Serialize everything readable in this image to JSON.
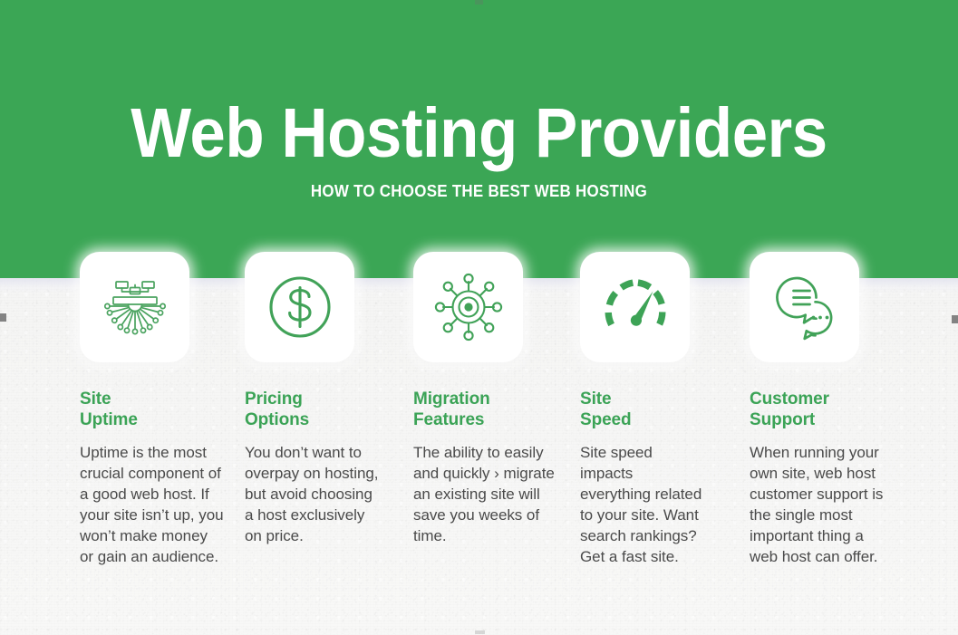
{
  "hero": {
    "title": "Web Hosting Providers",
    "subtitle": "HOW TO CHOOSE THE BEST WEB HOSTING",
    "background_color": "#3BA655",
    "text_color": "#FFFFFF"
  },
  "theme": {
    "brand_green": "#3BA655",
    "heading_green": "#3BA356",
    "body_text": "#4A4A4A",
    "card_background": "#FFFFFF",
    "page_background": "#F7F7F6"
  },
  "columns": [
    {
      "icon": "network-uptime-icon",
      "heading": "Site\nUptime",
      "body": "Uptime is the most crucial component of a good web host. If your site isn’t up, you won’t make money or gain an audience."
    },
    {
      "icon": "dollar-coin-icon",
      "heading": "Pricing\nOptions",
      "body": "You don’t want to overpay on hosting, but avoid choosing a host exclusively on price."
    },
    {
      "icon": "network-hub-icon",
      "heading": "Migration\nFeatures",
      "body": "The ability to easily and quickly  › migrate an existing site will save you weeks of time."
    },
    {
      "icon": "speedometer-icon",
      "heading": "Site\nSpeed",
      "body": "Site speed impacts everything related to your site. Want search rankings? Get a fast site."
    },
    {
      "icon": "chat-bubbles-icon",
      "heading": "Customer\nSupport",
      "body": "When running your own site, web host customer support is the single most important thing a web host can offer."
    }
  ]
}
